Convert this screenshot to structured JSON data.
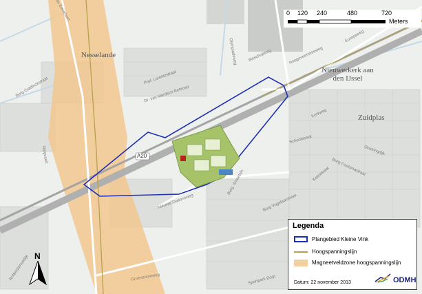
{
  "map": {
    "places": [
      {
        "name": "Nesselande"
      },
      {
        "name": "Nieuwerkerk aan den IJssel"
      },
      {
        "name": "Zuidplas"
      }
    ],
    "road_shield": "A20",
    "streets": [
      "Max Euwelaan",
      "Olympiadeweg",
      "Prof. Lorentzstraat",
      "Dr. van Mardech Rehmstr",
      "Bisschopweg",
      "Hoogeveensteeweg",
      "Europaweg",
      "Burg Guldinckstraat",
      "Kerkweg",
      "Ringvaart",
      "Burg Coolsmastraat",
      "Burg Vogelaarstraat",
      "Nieuwe Stationsweg",
      "Burg. Smeetsln",
      "Schoolstraat",
      "Oostringdijk",
      "Ketelstraat",
      "Sportpark Dorp",
      "Groenzoomweg",
      "Rotterdamsedijk"
    ]
  },
  "scale_bar": {
    "ticks": [
      "0",
      "120",
      "240",
      "480",
      "720"
    ],
    "unit": "Meters"
  },
  "north_arrow": {
    "label": "N"
  },
  "legend": {
    "title": "Legenda",
    "items": [
      {
        "label": "Plangebied Kleine Vink",
        "symbol": "outline",
        "color": "#1f2fb5"
      },
      {
        "label": "Hoogspanningslijn",
        "symbol": "line",
        "color": "#b5a24b"
      },
      {
        "label": "Magneetveldzone hoogspanningslijn",
        "symbol": "fill",
        "color": "#f2c88f"
      }
    ],
    "date": "Datum: 22 november 2013",
    "logo": "ODMH"
  }
}
